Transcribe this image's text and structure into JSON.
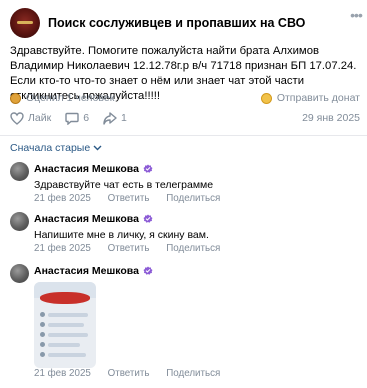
{
  "post": {
    "group_name": "Поиск сослуживцев и пропавших на СВО",
    "text": "Здравствуйте. Помогите пожалуйста найти брата Алхимов Владимир Николаевич 12.12.78г.р в/ч 71718 признан БП 17.07.24. Если кто-то что-то знает о нём или знает чат этой части откликнитесь пожалуйста!!!!!",
    "rated": "Оценил 1 человек",
    "donate": "Отправить донат",
    "likes_label": "Лайк",
    "comments_count": "6",
    "reposts_count": "1",
    "date": "29 янв 2025"
  },
  "sort_label": "Сначала старые",
  "comments": [
    {
      "author": "Анастасия Мешкова",
      "text": "Здравствуйте чат есть в телеграмме",
      "date": "21 фев 2025",
      "reply": "Ответить",
      "share": "Поделиться"
    },
    {
      "author": "Анастасия Мешкова",
      "text": "Напишите мне в личку, я скину вам.",
      "date": "21 фев 2025",
      "reply": "Ответить",
      "share": "Поделиться"
    },
    {
      "author": "Анастасия Мешкова",
      "text": "",
      "date": "21 фев 2025",
      "reply": "Ответить",
      "share": "Поделиться"
    }
  ],
  "colors": {
    "link": "#2a5885",
    "secondary": "#818c99",
    "badge": "#8c5cd6"
  },
  "icons": [
    "more-icon",
    "coin-icon",
    "heart-icon",
    "comment-icon",
    "share-icon",
    "chevron-down-icon",
    "verified-badge-icon"
  ]
}
